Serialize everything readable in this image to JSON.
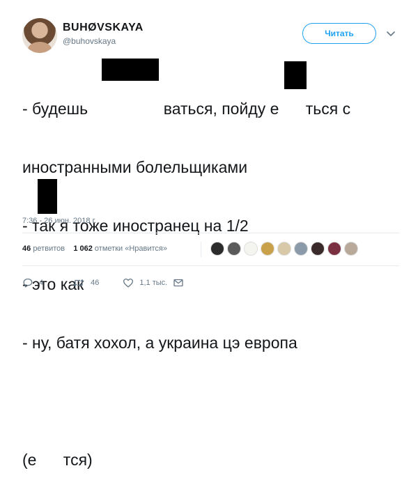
{
  "author": {
    "display_name": "BUHØVSKAYA",
    "handle": "@buhovskaya"
  },
  "follow_button": {
    "label": "Читать"
  },
  "tweet": {
    "lines": [
      "- будешь                 ваться, пойду е      ться с",
      "иностранными болельщиками",
      "- так я тоже иностранец на 1/2",
      "- это как",
      "- ну, батя хохол, а украина цэ европа",
      "",
      "(е      тся)"
    ],
    "timestamp": "7:36 - 26 июн. 2018 г."
  },
  "stats": {
    "retweets_count": "46",
    "retweets_label": "ретвитов",
    "likes_count": "1 062",
    "likes_label": "отметки «Нравится»"
  },
  "likers": [
    {
      "icon": "avatar-1",
      "color": "#2b2b2b"
    },
    {
      "icon": "avatar-2",
      "color": "#5a5a5a"
    },
    {
      "icon": "avatar-3",
      "color": "#f5f5f0"
    },
    {
      "icon": "avatar-4",
      "color": "#c9a14a"
    },
    {
      "icon": "avatar-5",
      "color": "#d8c9a8"
    },
    {
      "icon": "avatar-6",
      "color": "#8a9aa8"
    },
    {
      "icon": "avatar-7",
      "color": "#3b2a2a"
    },
    {
      "icon": "avatar-8",
      "color": "#7a3040"
    },
    {
      "icon": "avatar-9",
      "color": "#b8a99a"
    }
  ],
  "actions": {
    "reply_count": "4",
    "retweet_count": "46",
    "like_count": "1,1 тыс."
  },
  "colors": {
    "accent": "#1da1f2",
    "muted": "#657786",
    "redaction": "#000000"
  }
}
